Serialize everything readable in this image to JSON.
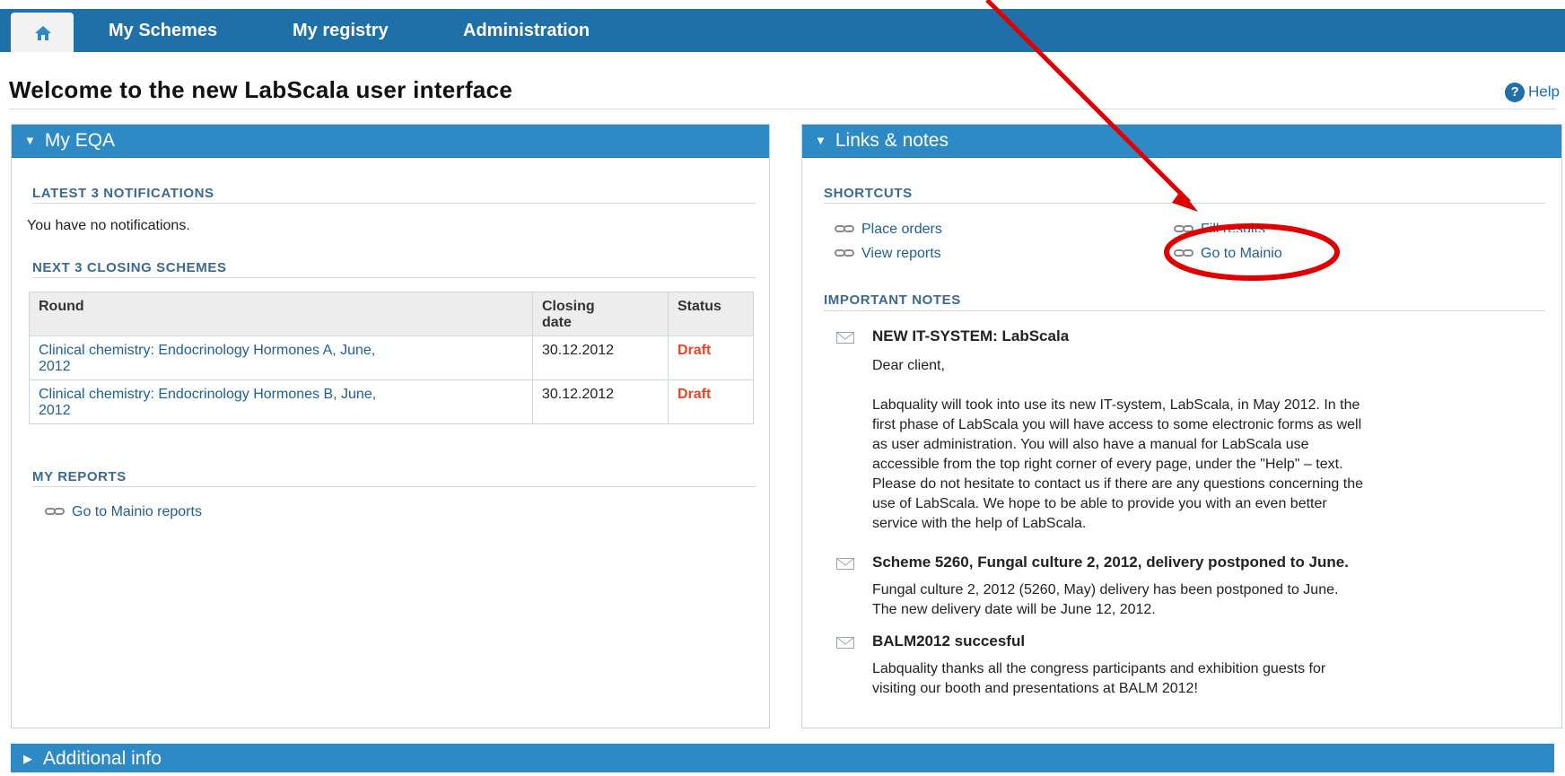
{
  "nav": {
    "items": [
      "My Schemes",
      "My registry",
      "Administration"
    ]
  },
  "header": {
    "title": "Welcome to the new LabScala user interface",
    "help": "Help"
  },
  "my_eqa": {
    "title": "My EQA",
    "notifications_heading": "LATEST 3 NOTIFICATIONS",
    "notifications_text": "You have no notifications.",
    "closing_heading": "NEXT 3 CLOSING SCHEMES",
    "table": {
      "col_round": "Round",
      "col_closing_1": "Closing",
      "col_closing_2": "date",
      "col_status": "Status",
      "rows": [
        {
          "round_1": "Clinical chemistry: Endocrinology Hormones A, June,",
          "round_2": "2012",
          "date": "30.12.2012",
          "status": "Draft"
        },
        {
          "round_1": "Clinical chemistry: Endocrinology Hormones B, June,",
          "round_2": "2012",
          "date": "30.12.2012",
          "status": "Draft"
        }
      ]
    },
    "reports_heading": "MY REPORTS",
    "reports_link": "Go to Mainio reports"
  },
  "links_notes": {
    "title": "Links & notes",
    "shortcuts_heading": "SHORTCUTS",
    "shortcuts": {
      "place_orders": "Place orders",
      "view_reports": "View reports",
      "fill_results": "Fill results",
      "go_to_mainio": "Go to Mainio"
    },
    "notes_heading": "IMPORTANT NOTES",
    "notes": [
      {
        "title": "NEW IT-SYSTEM: LabScala",
        "lines": [
          "Dear client,",
          "",
          "Labquality will took into use its new IT-system, LabScala, in May 2012. In the",
          "first phase of LabScala you will have access to some electronic forms as well",
          "as user administration. You will also have a manual for LabScala use",
          "accessible from the top right corner of every page, under the \"Help\" – text.",
          "Please do not hesitate to contact us if there are any questions concerning the",
          "use of LabScala. We hope to be able to provide you with an even better",
          "service with the help of LabScala."
        ]
      },
      {
        "title": "Scheme 5260, Fungal culture 2, 2012, delivery postponed to June.",
        "lines": [
          "Fungal culture 2, 2012 (5260, May) delivery has been postponed to June.",
          "The new delivery date will be June 12, 2012."
        ]
      },
      {
        "title": "BALM2012 succesful",
        "lines": [
          "Labquality thanks all the congress participants and exhibition guests for",
          "visiting our booth and presentations at BALM 2012!"
        ]
      }
    ]
  },
  "additional_info": "Additional info",
  "colors": {
    "nav_blue": "#1f6fa8",
    "panel_blue": "#2d8ac5",
    "status_draft": "#e04a2a",
    "annotation_red": "#e00000"
  }
}
